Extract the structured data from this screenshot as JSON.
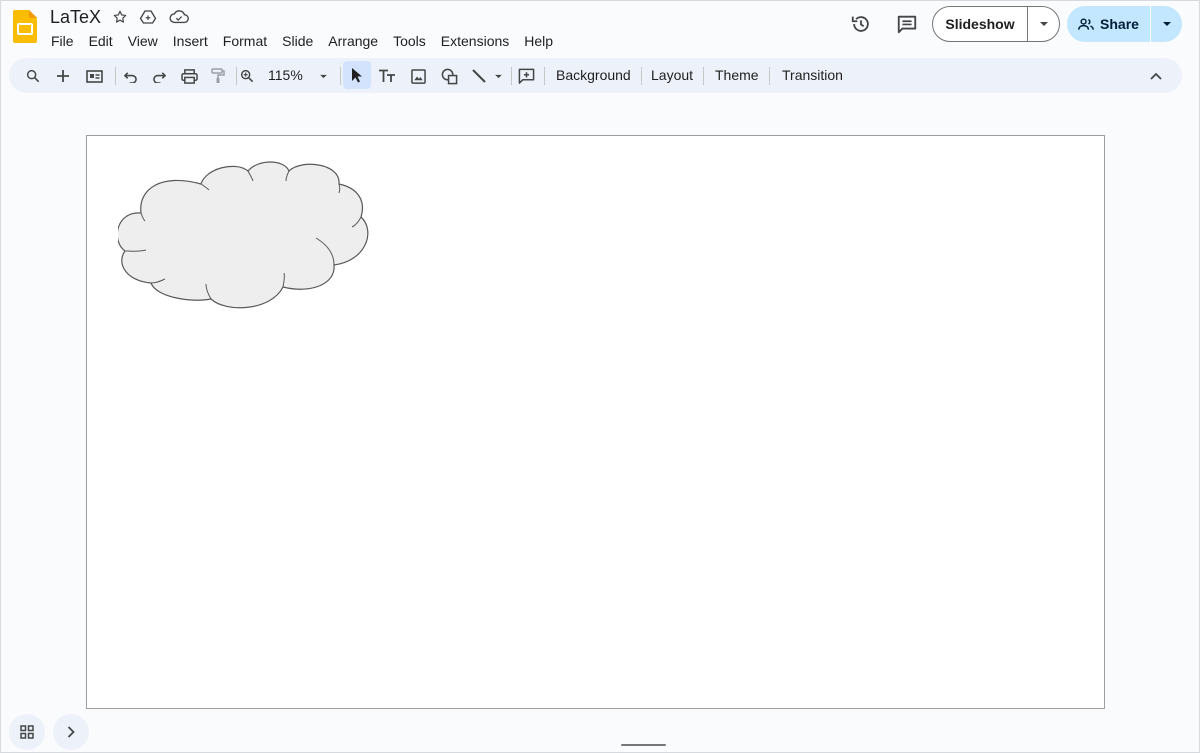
{
  "app": {
    "title": "LaTeX",
    "brand_color": "#fbbc04",
    "icons": [
      "star-icon",
      "move-to-drive-icon",
      "cloud-saved-icon"
    ]
  },
  "menu": [
    "File",
    "Edit",
    "View",
    "Insert",
    "Format",
    "Slide",
    "Arrange",
    "Tools",
    "Extensions",
    "Help"
  ],
  "header": {
    "history_icon": "history-icon",
    "comments_icon": "comments-icon",
    "slideshow_label": "Slideshow",
    "share_label": "Share",
    "share_color": "#c2e7ff"
  },
  "toolbar": {
    "zoom": "115%",
    "background_label": "Background",
    "layout_label": "Layout",
    "theme_label": "Theme",
    "transition_label": "Transition",
    "icons": [
      "search-icon",
      "new-slide-icon",
      "slide-layout-icon",
      "undo-icon",
      "redo-icon",
      "print-icon",
      "paint-format-icon",
      "zoom-icon",
      "select-icon",
      "text-box-icon",
      "image-icon",
      "shape-icon",
      "line-icon",
      "comment-add-icon",
      "collapse-icon"
    ]
  },
  "slide": {
    "shape": "cloud",
    "shape_fill": "#eeeeee",
    "shape_stroke": "#595959"
  },
  "bottom": {
    "grid_icon": "grid-view-icon",
    "expand_icon": "chevron-right-icon"
  }
}
